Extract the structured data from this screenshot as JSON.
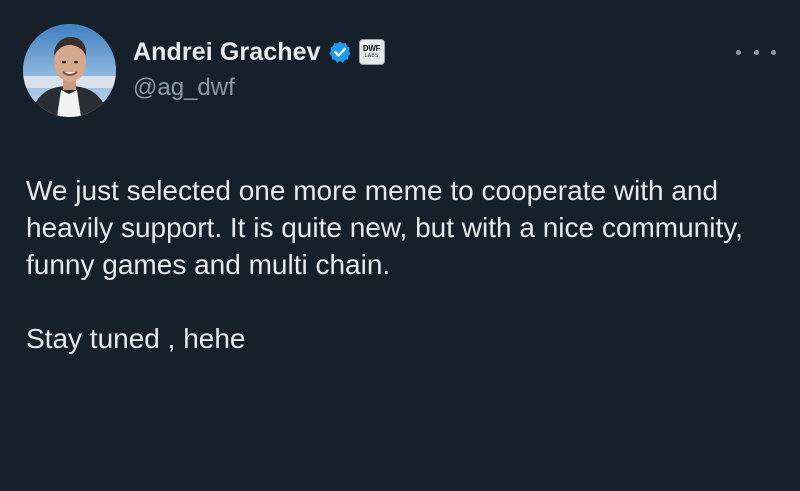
{
  "author": {
    "display_name": "Andrei Grachev",
    "handle": "@ag_dwf",
    "verified": true,
    "verified_icon": "verified-badge-icon",
    "affiliate_badge": {
      "top": "DWF",
      "bottom": "LABS"
    }
  },
  "tweet": {
    "paragraphs": [
      "We just selected one more meme to cooperate with and heavily support. It is quite new, but with a nice community, funny games and multi chain.",
      "Stay tuned , hehe"
    ]
  },
  "colors": {
    "background": "#15202b",
    "text_primary": "#e7e9ea",
    "text_secondary": "#8b98a5",
    "verified_blue": "#1d9bf0"
  },
  "icons": {
    "more": "more-options-icon"
  }
}
